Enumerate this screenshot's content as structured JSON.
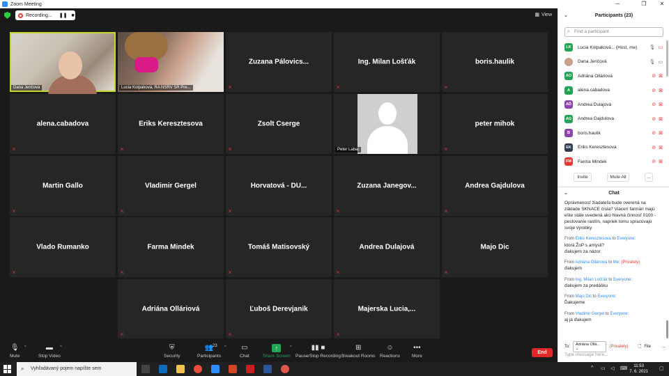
{
  "window": {
    "title": "Zoom Meeting"
  },
  "topbar": {
    "recording_label": "Recording...",
    "view_label": "View"
  },
  "tiles": [
    {
      "name": "Dana Jenčová",
      "kind": "video"
    },
    {
      "name": "Lucia Kolpaková, RA NSRV SR Pre...",
      "kind": "video"
    },
    {
      "name": "Zuzana  Pálovics..."
    },
    {
      "name": "Ing. Milan Lošťák"
    },
    {
      "name": "boris.haulik"
    },
    {
      "name": "alena.cabadova"
    },
    {
      "name": "Eriks Keresztesova"
    },
    {
      "name": "Zsolt Cserge"
    },
    {
      "name": "Peter Labaj",
      "kind": "avatar"
    },
    {
      "name": "peter mihok"
    },
    {
      "name": "Martin Gallo"
    },
    {
      "name": "Vladimir Gergel"
    },
    {
      "name": "Horvatová - DU..."
    },
    {
      "name": "Zuzana  Janegov..."
    },
    {
      "name": "Andrea Gajdulova"
    },
    {
      "name": "Vlado Rumanko"
    },
    {
      "name": "Farma Mindek"
    },
    {
      "name": "Tomáš Matisovský"
    },
    {
      "name": "Andrea Ďulajová"
    },
    {
      "name": "Majo Dic"
    },
    {
      "name": "Adriána Olláriová"
    },
    {
      "name": "Ľuboš Derevjanik"
    },
    {
      "name": "Majerska  Lucia,..."
    }
  ],
  "toolbar": {
    "mute": "Mute",
    "stop_video": "Stop Video",
    "security": "Security",
    "participants": "Participants",
    "participants_count": "23",
    "chat": "Chat",
    "share_screen": "Share Screen",
    "pause_recording": "Pause/Stop Recording",
    "breakout": "Breakout Rooms",
    "reactions": "Reactions",
    "more": "More",
    "end": "End"
  },
  "participants_panel": {
    "title": "Participants (23)",
    "search_placeholder": "Find a participant",
    "items": [
      {
        "initials": "LK",
        "name": "Lucia Kolpaková... (Host, me)",
        "color": "#23a455"
      },
      {
        "initials": "",
        "name": "Dana Jenčová",
        "color": "#c9a08c"
      },
      {
        "initials": "AO",
        "name": "Adriána Olláriová",
        "color": "#23a455"
      },
      {
        "initials": "A",
        "name": "alena.cabadova",
        "color": "#23a455"
      },
      {
        "initials": "AĎ",
        "name": "Andrea Ďulajová",
        "color": "#8e44ad"
      },
      {
        "initials": "AG",
        "name": "Andrea Gajdulova",
        "color": "#23a455"
      },
      {
        "initials": "B",
        "name": "boris.haulik",
        "color": "#8e44ad"
      },
      {
        "initials": "EK",
        "name": "Eriks Keresztesova",
        "color": "#2c3e50"
      },
      {
        "initials": "FM",
        "name": "Farma Mindek",
        "color": "#e53935"
      }
    ],
    "invite": "Invite",
    "mute_all": "Mute All",
    "more": "..."
  },
  "chat": {
    "title": "Chat",
    "messages": [
      {
        "text": "Oprávnenosť žiadateľa bude overená na základe SKNACE čísla? Viacerí farmári majú ešte stále uvedená ako hlavná činnosť 0100 - pestovanie rastlín, napriek tomu spracúvajú svoje výrobky"
      },
      {
        "from": "Eriks Keresztesova",
        "to": "Everyone",
        "text": "ktorá ŽoP s amysli?\nďakujem za názor"
      },
      {
        "from": "Adriána Olláriová",
        "to": "Me",
        "private": "(Privately)",
        "text": "ďakujem"
      },
      {
        "from": "Ing. Milan Lošťák",
        "to": "Everyone",
        "text": "ďakujem za predášku"
      },
      {
        "from": "Majo Dic",
        "to": "Everyone",
        "text": "Ďakujeme"
      },
      {
        "from": "Vladimir Gergel",
        "to": "Everyone",
        "text": "aj ja ďakujem"
      }
    ],
    "labels": {
      "from": "From",
      "to": "to",
      "to_colon": ":"
    },
    "to_label": "To:",
    "to_value": "Adriána Ollá...",
    "privately": "(Privately)",
    "file": "File",
    "more": "...",
    "placeholder": "Type message here..."
  },
  "taskbar": {
    "search_placeholder": "Vyhľadávaný pojem napíšte sem",
    "time": "11:53",
    "date": "7. 6. 2021"
  }
}
